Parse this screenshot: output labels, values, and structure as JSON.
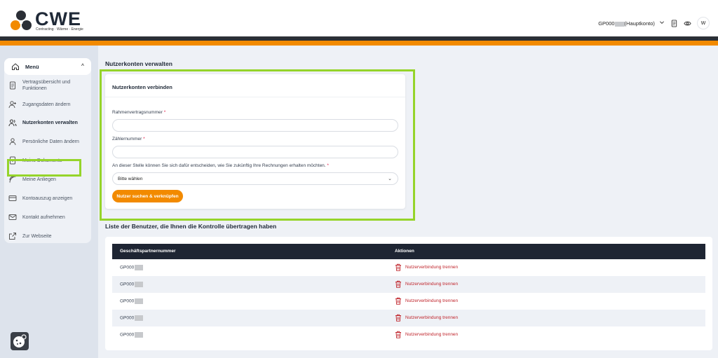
{
  "header": {
    "brand": "CWE",
    "tagline": "Contracting · Wärme · Energie",
    "account_prefix": "GP000",
    "account_suffix": "(Hauptkonto)",
    "avatar_initial": "W"
  },
  "sidebar": {
    "menu_label": "Menü",
    "items": [
      {
        "label": "Vertragsübersicht und Funktionen",
        "icon": "document-icon"
      },
      {
        "label": "Zugangsdaten ändern",
        "icon": "user-plus-icon"
      },
      {
        "label": "Nutzerkonten verwalten",
        "icon": "users-icon",
        "active": true
      },
      {
        "label": "Persönliche Daten ändern",
        "icon": "user-icon"
      },
      {
        "label": "Meine Dokumente",
        "icon": "file-plus-icon"
      },
      {
        "label": "Meine Anliegen",
        "icon": "feed-icon"
      },
      {
        "label": "Kontoauszug anzeigen",
        "icon": "credit-card-icon"
      },
      {
        "label": "Kontakt aufnehmen",
        "icon": "mail-icon"
      },
      {
        "label": "Zur Webseite",
        "icon": "external-link-icon"
      }
    ]
  },
  "main": {
    "title": "Nutzerkonten verwalten",
    "form": {
      "title": "Nutzerkonten verbinden",
      "field1_label": "Rahmenvertragsnummer",
      "field2_label": "Zählernummer",
      "field3_label": "An dieser Stelle können Sie sich dafür entscheiden, wie Sie zukünftig Ihre Rechnungen erhalten möchten.",
      "required_mark": "*",
      "select_value": "Bitte wählen",
      "button_label": "Nutzer suchen & verknüpfen"
    },
    "list": {
      "title": "Liste der Benutzer, die Ihnen die Kontrolle übertragen haben",
      "col1": "Geschäftspartnernummer",
      "col2": "Aktionen",
      "rows": [
        {
          "gp": "GP000",
          "action": "Nutzerverbindung trennen"
        },
        {
          "gp": "GP000",
          "action": "Nutzerverbindung trennen"
        },
        {
          "gp": "GP000",
          "action": "Nutzerverbindung trennen"
        },
        {
          "gp": "GP000",
          "action": "Nutzerverbindung trennen"
        },
        {
          "gp": "GP000",
          "action": "Nutzerverbindung trennen"
        }
      ]
    }
  },
  "colors": {
    "accent": "#f28a00",
    "highlight": "#95d42a",
    "danger": "#c0262d",
    "table_header": "#1e2533"
  }
}
